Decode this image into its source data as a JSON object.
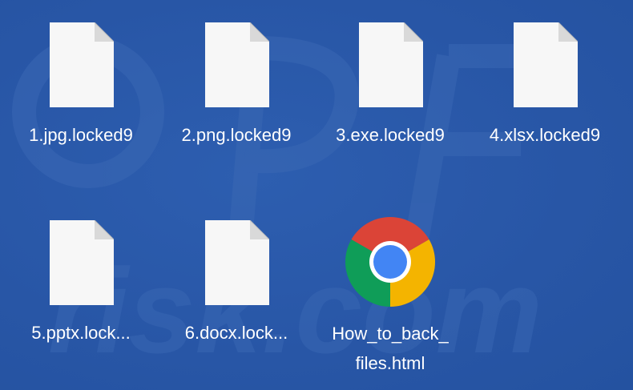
{
  "desktop": {
    "background": "#2a58a8",
    "icons": [
      {
        "name": "1.jpg.locked9",
        "icon": "blank-file-icon"
      },
      {
        "name": "2.png.locked9",
        "icon": "blank-file-icon"
      },
      {
        "name": "3.exe.locked9",
        "icon": "blank-file-icon"
      },
      {
        "name": "4.xlsx.locked9",
        "icon": "blank-file-icon"
      },
      {
        "name": "5.pptx.lock...",
        "icon": "blank-file-icon"
      },
      {
        "name": "6.docx.lock...",
        "icon": "blank-file-icon"
      },
      {
        "name_line1": "How_to_back_",
        "name_line2": "files.html",
        "icon": "chrome-icon"
      }
    ]
  },
  "watermark": {
    "text": "risk.com",
    "color": "#4a74bb"
  }
}
